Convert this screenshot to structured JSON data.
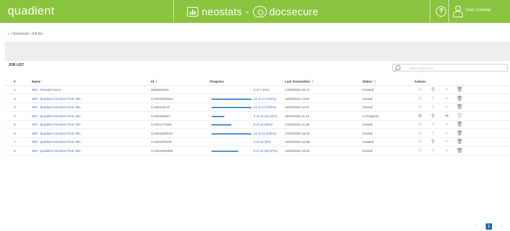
{
  "header": {
    "logo": "quadient",
    "brand_left": "neostats",
    "brand_sep": "-",
    "brand_right": "docsecure",
    "help": "?",
    "user_name": "User Conway",
    "color": "#8ac43f"
  },
  "breadcrumb": {
    "home": "⌂",
    "path": " / docsecure / Job list"
  },
  "joblist": {
    "title": "JOB LIST",
    "search_placeholder": "Search jobs here"
  },
  "table": {
    "columns": [
      "#",
      "Name",
      "Id",
      "Progress",
      "Last Transaction",
      "Status",
      "Actions"
    ],
    "sort_name": "^",
    "sort_other": "⇅",
    "rows": [
      {
        "num": "1",
        "name": "WR - Firewall source",
        "id": "WB0003X01",
        "progress_text": "0 of 1 (0%)",
        "progress": 0,
        "last": "17/05/2022 15:47",
        "status": "Created",
        "actions": [
          false,
          true,
          false,
          true
        ]
      },
      {
        "num": "2",
        "name": "WR - Quadient Services Prod. Wiv",
        "id": "CASK1W3ZW1",
        "progress_text": "12 of 12 (100%)",
        "progress": 100,
        "last": "11/02/2022 13:02",
        "status": "Closed",
        "actions": [
          false,
          false,
          false,
          true
        ]
      },
      {
        "num": "3",
        "name": "WR - Quadient Services Prod. Wiv",
        "id": "CASK1WL0T",
        "progress_text": "12 of 12 (100%)",
        "progress": 100,
        "last": "11/02/2022 14:37",
        "status": "Closed",
        "actions": [
          false,
          false,
          false,
          true
        ]
      },
      {
        "num": "4",
        "name": "WR - Quadient Services Prod. Wiv",
        "id": "CASK15WZV",
        "progress_text": "4 of 12 (33.33%)",
        "progress": 33.33,
        "last": "15/02/2022 11:15",
        "status": "In Progress",
        "actions": [
          true,
          true,
          true,
          false
        ]
      },
      {
        "num": "5",
        "name": "WR - Quadient Services Prod. Wiv",
        "id": "CASK17YSK9",
        "progress_text": "6 of 12 (50%)",
        "progress": 50,
        "last": "17/02/2022 11:08",
        "status": "Closed",
        "actions": [
          false,
          false,
          false,
          true
        ]
      },
      {
        "num": "6",
        "name": "WR - Quadient Services Prod. Wiv",
        "id": "CASK2ZDROH",
        "progress_text": "12 of 12 (100%)",
        "progress": 100,
        "last": "17/02/2022 15:43",
        "status": "Closed",
        "actions": [
          false,
          false,
          false,
          true
        ]
      },
      {
        "num": "7",
        "name": "WR - Quadient Services Prod. Wiv",
        "id": "CASK2ZF5HD",
        "progress_text": "0 of 12 (0%)",
        "progress": 0,
        "last": "22/03/2022 15:39",
        "status": "Created",
        "actions": [
          false,
          true,
          false,
          true
        ]
      },
      {
        "num": "8",
        "name": "WR - Quadient Services Prod. Wiv",
        "id": "CASK2ZDMHE",
        "progress_text": "8 of 12 (66.67%)",
        "progress": 66.67,
        "last": "12/04/2022 10:16",
        "status": "Closed",
        "actions": [
          false,
          false,
          false,
          true
        ]
      }
    ]
  },
  "pagination": {
    "first": "«",
    "prev": "‹",
    "current": "1",
    "next": "›",
    "last": "»"
  },
  "icons": {
    "action1": "check-circle-icon",
    "action2": "person-search-icon",
    "action3": "export-icon",
    "action4": "trash-icon"
  }
}
